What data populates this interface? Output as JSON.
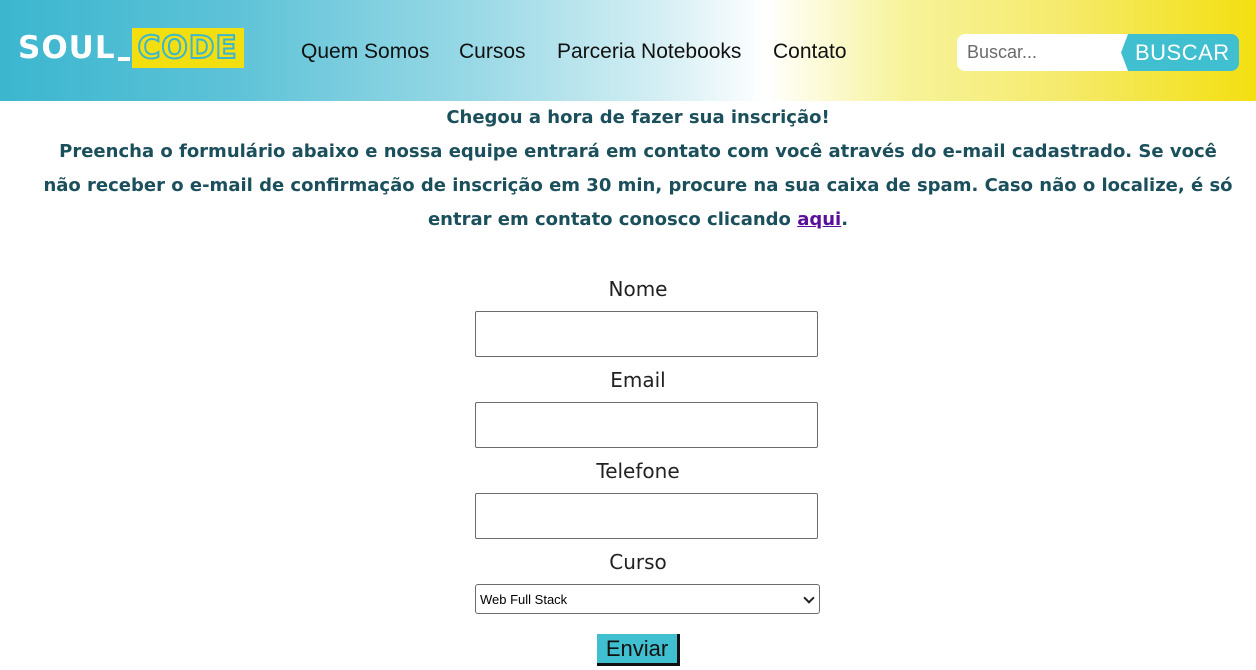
{
  "header": {
    "logo": {
      "part1": "SOUL",
      "part2": "CODE"
    },
    "nav": [
      "Quem Somos",
      "Cursos",
      "Parceria Notebooks",
      "Contato"
    ],
    "search": {
      "placeholder": "Buscar...",
      "value": "",
      "button_label": "BUSCAR"
    },
    "colors": {
      "gradient_start": "#3bb6cf",
      "gradient_end": "#f3df10",
      "accent": "#3fbfcf"
    }
  },
  "intro": {
    "heading": "Chegou a hora de fazer sua inscrição!",
    "text": "Preencha o formulário abaixo e nossa equipe entrará em contato com você através do e-mail cadastrado. Se você não receber o e-mail de confirmação de inscrição em 30 min, procure na sua caixa de spam. Caso não o localize, é só entrar em contato conosco clicando ",
    "link_label": "aqui",
    "text_end": "."
  },
  "form": {
    "name_label": "Nome",
    "name_value": "",
    "email_label": "Email",
    "email_value": "",
    "phone_label": "Telefone",
    "phone_value": "",
    "course_label": "Curso",
    "course_selected": "Web Full Stack",
    "submit_label": "Enviar"
  }
}
